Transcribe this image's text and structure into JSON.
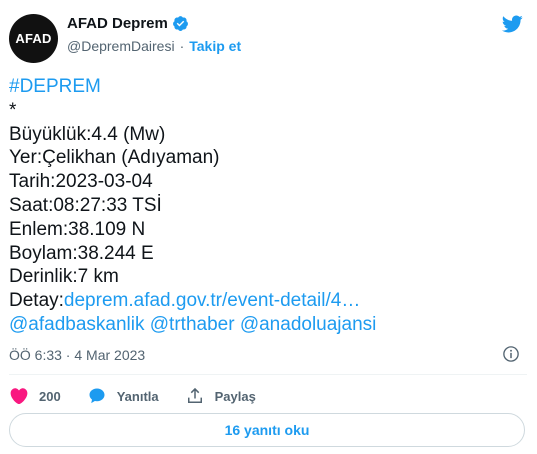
{
  "author": {
    "avatar_text": "AFAD",
    "display_name": "AFAD Deprem",
    "handle": "@DepremDairesi",
    "separator": "·",
    "follow_label": "Takip et"
  },
  "tweet": {
    "lines": [
      {
        "parts": [
          {
            "text": "#DEPREM",
            "link": true
          }
        ]
      },
      {
        "parts": [
          {
            "text": "*",
            "link": false
          }
        ]
      },
      {
        "parts": [
          {
            "text": "Büyüklük:4.4 (Mw)",
            "link": false
          }
        ]
      },
      {
        "parts": [
          {
            "text": "Yer:Çelikhan (Adıyaman)",
            "link": false
          }
        ]
      },
      {
        "parts": [
          {
            "text": "Tarih:2023-03-04",
            "link": false
          }
        ]
      },
      {
        "parts": [
          {
            "text": "Saat:08:27:33 TSİ",
            "link": false
          }
        ]
      },
      {
        "parts": [
          {
            "text": "Enlem:38.109 N",
            "link": false
          }
        ]
      },
      {
        "parts": [
          {
            "text": "Boylam:38.244 E",
            "link": false
          }
        ]
      },
      {
        "parts": [
          {
            "text": "Derinlik:7 km",
            "link": false
          }
        ]
      },
      {
        "parts": [
          {
            "text": "Detay:",
            "link": false
          },
          {
            "text": "deprem.afad.gov.tr/event-detail/4…",
            "link": true
          }
        ]
      },
      {
        "parts": [
          {
            "text": "@afadbaskanlik",
            "link": true
          },
          {
            "text": " ",
            "link": false
          },
          {
            "text": "@trthaber",
            "link": true
          },
          {
            "text": " ",
            "link": false
          },
          {
            "text": "@anadoluajansi",
            "link": true
          }
        ]
      }
    ],
    "timestamp": "ÖÖ 6:33 · 4 Mar 2023"
  },
  "actions": {
    "like_count": "200",
    "reply_label": "Yanıtla",
    "share_label": "Paylaş",
    "read_replies_label": "16 yanıtı oku"
  },
  "colors": {
    "link": "#1d9bf0",
    "like": "#f91880",
    "secondary_text": "#536471",
    "verified": "#1d9bf0"
  },
  "icons": {
    "verified": "verified-badge-icon",
    "bird": "twitter-bird-icon",
    "info": "info-icon",
    "like": "heart-icon",
    "reply": "speech-bubble-icon",
    "share": "share-icon"
  }
}
